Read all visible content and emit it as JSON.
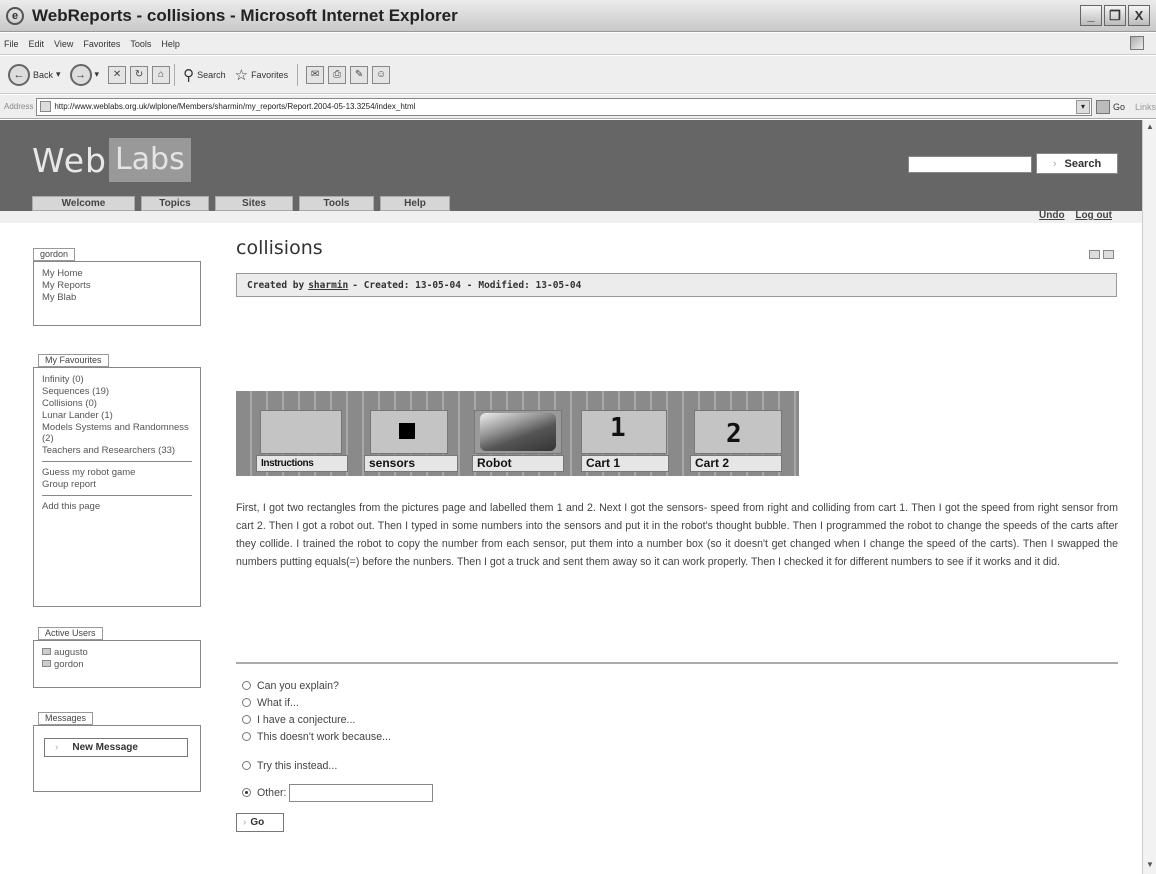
{
  "window": {
    "title": "WebReports - collisions - Microsoft Internet Explorer",
    "controls": [
      "_",
      "❐",
      "X"
    ]
  },
  "menubar": [
    "File",
    "Edit",
    "View",
    "Favorites",
    "Tools",
    "Help"
  ],
  "toolbar": {
    "back": "Back",
    "search": "Search",
    "favorites": "Favorites"
  },
  "addressbar": {
    "label": "Address",
    "url": "http://www.weblabs.org.uk/wlplone/Members/sharmin/my_reports/Report.2004-05-13.3254/index_html",
    "go": "Go",
    "links": "Links"
  },
  "site": {
    "logo_web": "Web",
    "logo_labs": "Labs",
    "search_button": "Search",
    "nav": [
      "Welcome",
      "Topics",
      "Sites",
      "Tools",
      "Help"
    ],
    "undo": "Undo",
    "logout": "Log out"
  },
  "sidebar": {
    "user": {
      "title": "gordon",
      "items": [
        "My Home",
        "My Reports",
        "My Blab"
      ]
    },
    "favourites": {
      "title": "My Favourites",
      "items": [
        "Infinity (0)",
        "Sequences (19)",
        "Collisions (0)",
        "Lunar Lander (1)",
        "Models Systems and Randomness (2)",
        "Teachers and Researchers (33)"
      ],
      "extra": [
        "Guess my robot game",
        "Group report"
      ],
      "add": "Add this page"
    },
    "active_users": {
      "title": "Active Users",
      "items": [
        "augusto",
        "gordon"
      ]
    },
    "messages": {
      "title": "Messages",
      "button": "New Message"
    }
  },
  "document": {
    "title": "collisions",
    "byline_created_by": "Created by",
    "author": "sharmin",
    "created": "- Created: 13-05-04 -",
    "modified": "Modified: 13-05-04",
    "game_labels": [
      "Instructions",
      "sensors",
      "Robot",
      "Cart 1",
      "Cart 2"
    ],
    "cart_numbers": [
      "1",
      "2"
    ],
    "body": "First, I got two rectangles from the pictures page and labelled them 1 and 2. Next I got the sensors- speed from right and colliding from cart 1. Then I got the speed from right sensor from cart 2. Then I got a robot out. Then I typed in some numbers into the sensors and put it in the robot's thought bubble. Then I programmed the robot to change the speeds of the carts after they collide. I trained the robot to copy the number from each sensor, put them into a number box (so it doesn't get changed when I change the speed of the carts). Then I swapped the numbers putting equals(=) before the nunbers. Then I got a truck and sent them away so it can work properly. Then I checked it for different numbers to see if it works and it did."
  },
  "reply": {
    "options": [
      "Can you explain?",
      "What if...",
      "I have a conjecture...",
      "This doesn't work because..."
    ],
    "try_this": "Try this instead...",
    "other": "Other:",
    "submit": "Go"
  }
}
